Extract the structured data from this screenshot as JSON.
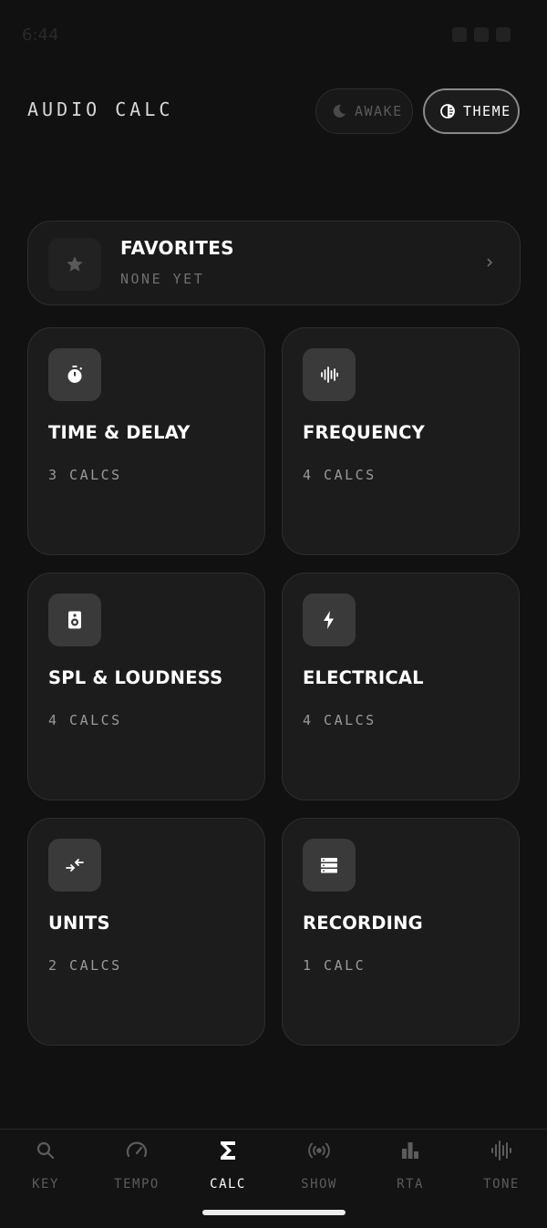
{
  "status_bar": {
    "time": "6:44"
  },
  "header": {
    "title": "AUDIO CALC",
    "awake_label": "AWAKE",
    "theme_label": "THEME"
  },
  "favorites": {
    "title": "FAVORITES",
    "subtitle": "NONE YET",
    "icon": "star-icon"
  },
  "categories": [
    {
      "title": "TIME & DELAY",
      "count": "3 CALCS",
      "icon": "stopwatch-icon"
    },
    {
      "title": "FREQUENCY",
      "count": "4 CALCS",
      "icon": "waveform-icon"
    },
    {
      "title": "SPL & LOUDNESS",
      "count": "4 CALCS",
      "icon": "speaker-icon"
    },
    {
      "title": "ELECTRICAL",
      "count": "4 CALCS",
      "icon": "lightning-icon"
    },
    {
      "title": "UNITS",
      "count": "2 CALCS",
      "icon": "convert-arrows-icon"
    },
    {
      "title": "RECORDING",
      "count": "1 CALC",
      "icon": "storage-icon"
    }
  ],
  "nav": {
    "active": "CALC",
    "items": [
      {
        "label": "KEY",
        "icon": "search-icon"
      },
      {
        "label": "TEMPO",
        "icon": "speedometer-icon"
      },
      {
        "label": "CALC",
        "icon": "sigma-icon"
      },
      {
        "label": "SHOW",
        "icon": "broadcast-icon"
      },
      {
        "label": "RTA",
        "icon": "bar-chart-icon"
      },
      {
        "label": "TONE",
        "icon": "waveform-icon"
      }
    ]
  },
  "colors": {
    "background": "#111111",
    "card": "#1c1c1c",
    "icon_box": "#3a3a3a",
    "text": "#ffffff",
    "muted": "#9a9a9a"
  }
}
